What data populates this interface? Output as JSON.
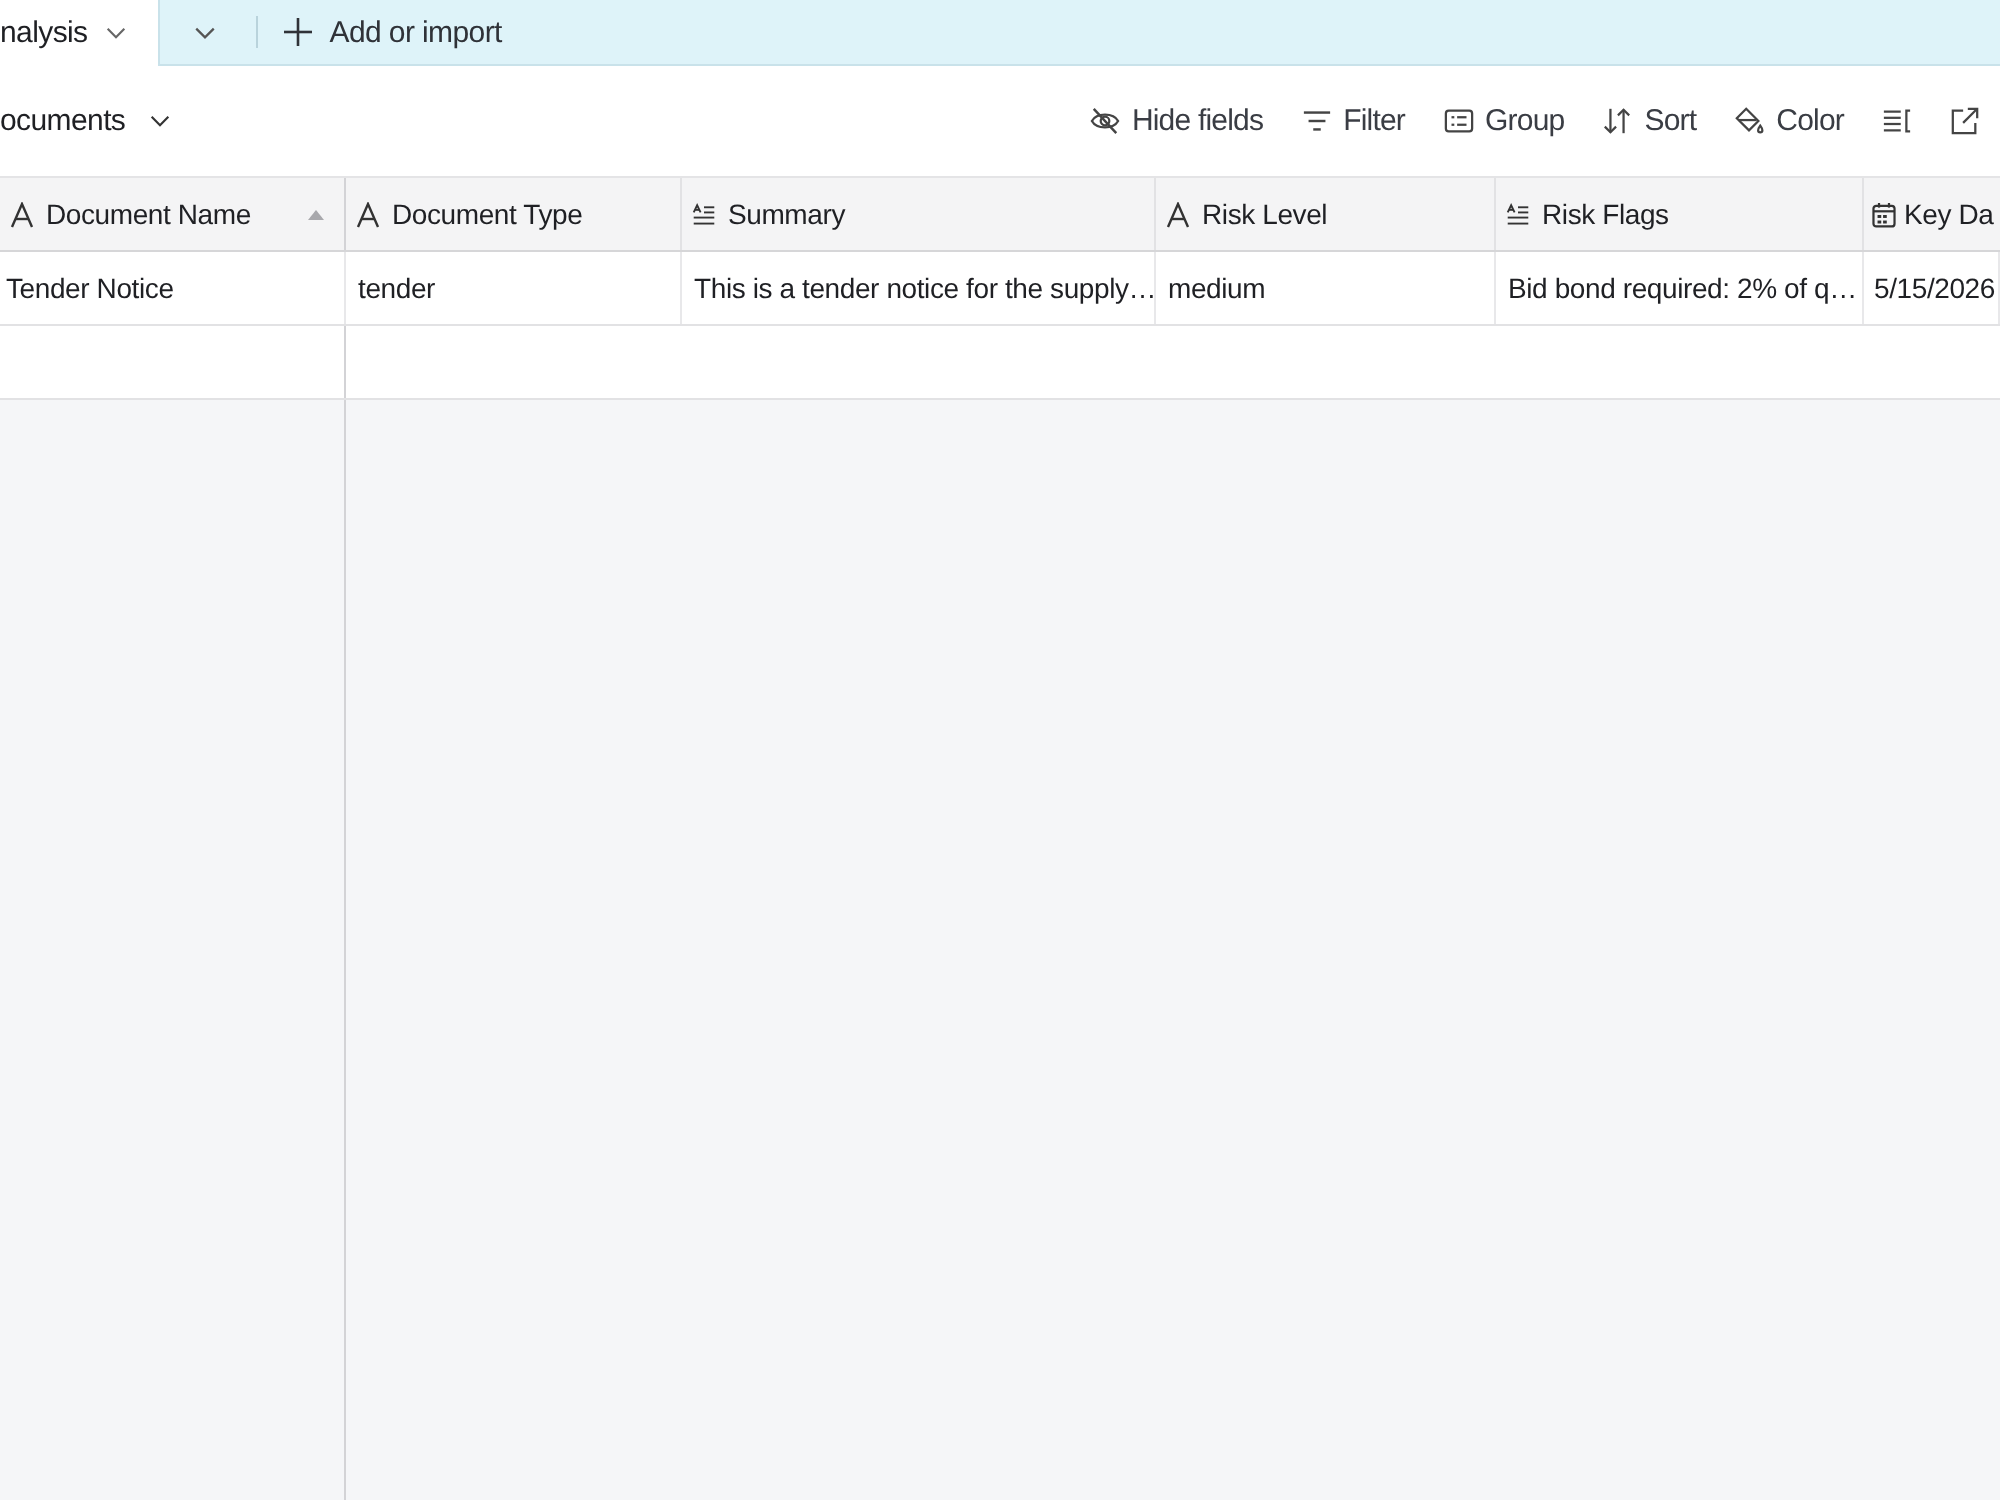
{
  "tab_bar": {
    "tabs": [
      {
        "label": "nalysis",
        "selected": true
      }
    ],
    "add_button": {
      "label": "Add or import"
    }
  },
  "view_bar": {
    "view_name": "ocuments",
    "tools": [
      {
        "kind": "hide_fields",
        "label": "Hide fields"
      },
      {
        "kind": "filter",
        "label": "Filter"
      },
      {
        "kind": "group",
        "label": "Group"
      },
      {
        "kind": "sort",
        "label": "Sort"
      },
      {
        "kind": "color",
        "label": "Color"
      },
      {
        "kind": "row_height"
      },
      {
        "kind": "share"
      }
    ]
  },
  "table": {
    "columns": [
      {
        "label": "Document Name",
        "kind": "text",
        "sorted": true
      },
      {
        "label": "Document Type",
        "kind": "text",
        "sorted": false
      },
      {
        "label": "Summary",
        "kind": "long_text",
        "sorted": false
      },
      {
        "label": "Risk Level",
        "kind": "text",
        "sorted": false
      },
      {
        "label": "Risk Flags",
        "kind": "long_text",
        "sorted": false
      },
      {
        "label": "Key Da",
        "kind": "date",
        "sorted": false
      }
    ],
    "rows": [
      {
        "cells": [
          "Tender Notice",
          "tender",
          "This is a tender notice for the supply…",
          "medium",
          "Bid bond required: 2% of q…",
          "5/15/2026"
        ]
      }
    ]
  }
}
